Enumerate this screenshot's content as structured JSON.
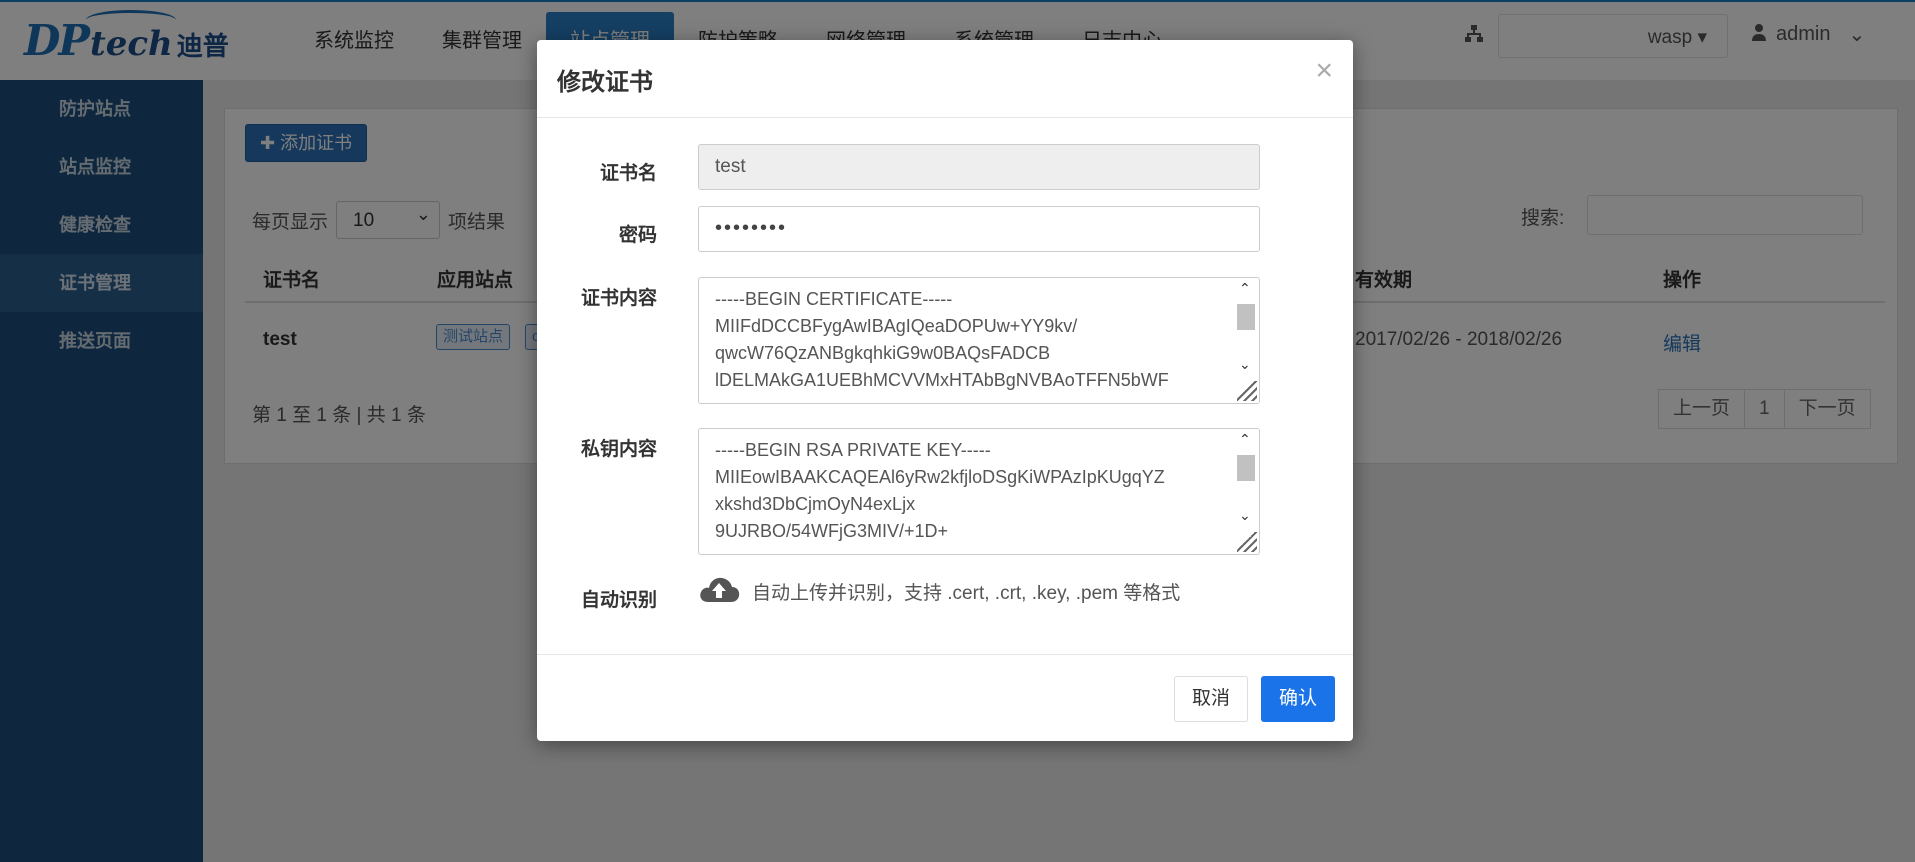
{
  "brand": {
    "logo_dp": "DP",
    "logo_tech": "tech",
    "logo_cn": "迪普"
  },
  "nav": [
    {
      "label": "系统监控"
    },
    {
      "label": "集群管理"
    },
    {
      "label": "站点管理"
    },
    {
      "label": "防护策略"
    },
    {
      "label": "网络管理"
    },
    {
      "label": "系统管理"
    },
    {
      "label": "日志中心"
    }
  ],
  "header": {
    "device_select": "wasp",
    "user": "admin"
  },
  "sidebar": {
    "items": [
      {
        "label": "防护站点"
      },
      {
        "label": "站点监控"
      },
      {
        "label": "健康检查"
      },
      {
        "label": "证书管理"
      },
      {
        "label": "推送页面"
      }
    ]
  },
  "main": {
    "add_button": "添加证书",
    "per_page_label": "每页显示",
    "per_page_value": "10",
    "per_page_suffix": "项结果",
    "search_label": "搜索:",
    "columns": [
      "证书名",
      "应用站点",
      "有效期",
      "操作"
    ],
    "rows": [
      {
        "name": "test",
        "sites": [
          "测试站点",
          "c"
        ],
        "validity": "2017/02/26 - 2018/02/26",
        "action": "编辑"
      }
    ],
    "info": "第 1 至 1 条 | 共 1 条",
    "pager": {
      "prev": "上一页",
      "page": "1",
      "next": "下一页"
    }
  },
  "modal": {
    "title": "修改证书",
    "close": "×",
    "name_label": "证书名",
    "name_value": "test",
    "password_label": "密码",
    "password_value": "••••••••",
    "cert_label": "证书内容",
    "cert_value": "-----BEGIN CERTIFICATE-----\nMIIFdDCCBFygAwIBAgIQeaDOPUw+YY9kv/\nqwcW76QzANBgkqhkiG9w0BAQsFADCB\nlDELMAkGA1UEBhMCVVMxHTAbBgNVBAoTFFN5bWF",
    "key_label": "私钥内容",
    "key_value": "-----BEGIN RSA PRIVATE KEY-----\nMIIEowIBAAKCAQEAl6yRw2kfjloDSgKiWPAzIpKUgqYZ\nxkshd3DbCjmOyN4exLjx\n9UJRBO/54WFjG3MIV/+1D+",
    "auto_label": "自动识别",
    "auto_hint": "自动上传并识别，支持 .cert, .crt, .key, .pem 等格式",
    "cancel": "取消",
    "confirm": "确认"
  }
}
